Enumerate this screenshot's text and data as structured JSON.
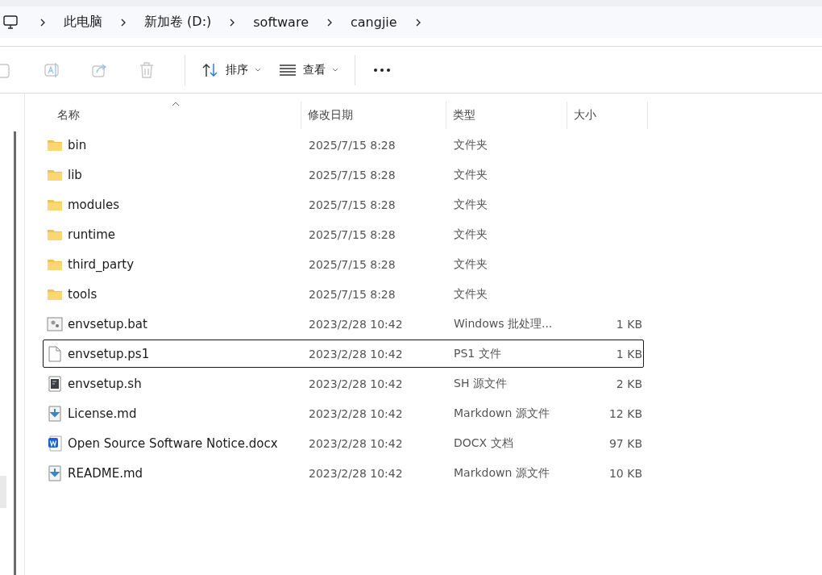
{
  "breadcrumb": [
    "此电脑",
    "新加卷 (D:)",
    "software",
    "cangjie"
  ],
  "toolbar": {
    "sort": {
      "label": "排序"
    },
    "view": {
      "label": "查看"
    }
  },
  "table": {
    "columns": [
      "名称",
      "修改日期",
      "类型",
      "大小"
    ],
    "rows": [
      {
        "kind": "folder",
        "name": "bin",
        "date": "2025/7/15 8:28",
        "type": "文件夹",
        "size": "",
        "selected": false
      },
      {
        "kind": "folder",
        "name": "lib",
        "date": "2025/7/15 8:28",
        "type": "文件夹",
        "size": "",
        "selected": false
      },
      {
        "kind": "folder",
        "name": "modules",
        "date": "2025/7/15 8:28",
        "type": "文件夹",
        "size": "",
        "selected": false
      },
      {
        "kind": "folder",
        "name": "runtime",
        "date": "2025/7/15 8:28",
        "type": "文件夹",
        "size": "",
        "selected": false
      },
      {
        "kind": "folder",
        "name": "third_party",
        "date": "2025/7/15 8:28",
        "type": "文件夹",
        "size": "",
        "selected": false
      },
      {
        "kind": "folder",
        "name": "tools",
        "date": "2025/7/15 8:28",
        "type": "文件夹",
        "size": "",
        "selected": false
      },
      {
        "kind": "batch",
        "name": "envsetup.bat",
        "date": "2023/2/28 10:42",
        "type": "Windows 批处理...",
        "size": "1 KB",
        "selected": false
      },
      {
        "kind": "blank",
        "name": "envsetup.ps1",
        "date": "2023/2/28 10:42",
        "type": "PS1 文件",
        "size": "1 KB",
        "selected": true
      },
      {
        "kind": "script",
        "name": "envsetup.sh",
        "date": "2023/2/28 10:42",
        "type": "SH 源文件",
        "size": "2 KB",
        "selected": false
      },
      {
        "kind": "markdown",
        "name": "License.md",
        "date": "2023/2/28 10:42",
        "type": "Markdown 源文件",
        "size": "12 KB",
        "selected": false
      },
      {
        "kind": "word",
        "name": "Open Source Software Notice.docx",
        "date": "2023/2/28 10:42",
        "type": "DOCX 文档",
        "size": "97 KB",
        "selected": false
      },
      {
        "kind": "markdown",
        "name": "README.md",
        "date": "2023/2/28 10:42",
        "type": "Markdown 源文件",
        "size": "10 KB",
        "selected": false
      }
    ]
  }
}
